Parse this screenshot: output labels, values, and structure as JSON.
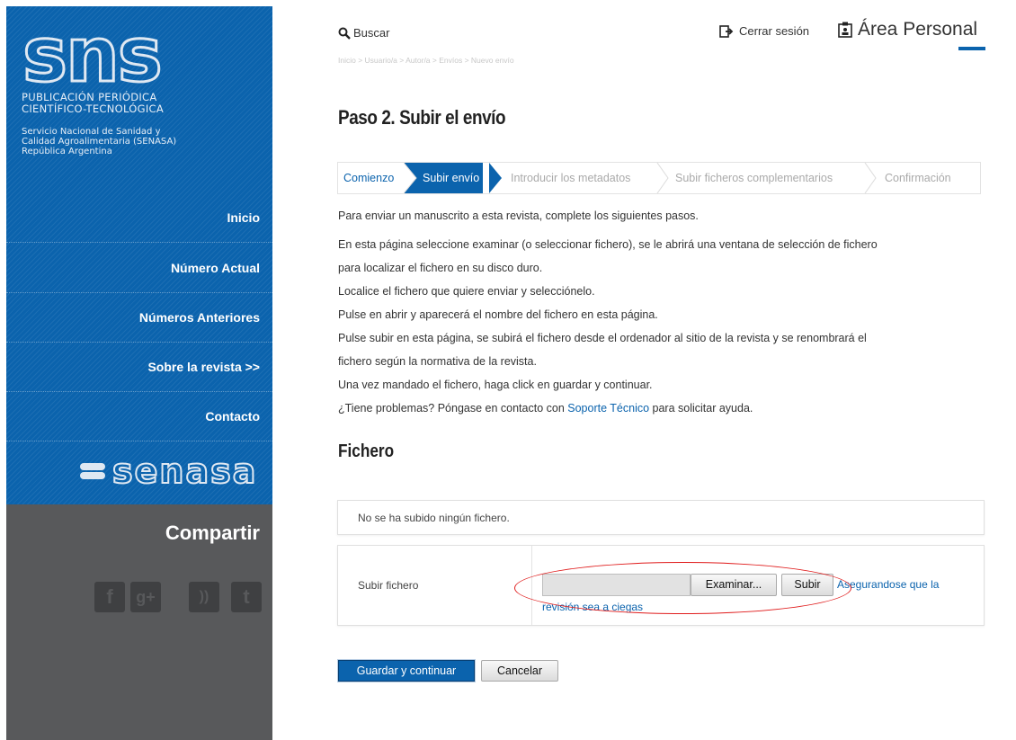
{
  "sidebar": {
    "logo_text": "sns",
    "pub_line1": "PUBLICACIÓN   PERIÓDICA",
    "pub_line2": "CIENTÍFICO-TECNOLÓGICA",
    "service_line1": "Servicio Nacional de Sanidad y",
    "service_line2": "Calidad Agroalimentaria (SENASA)",
    "service_line3": "República Argentina",
    "nav": [
      "Inicio",
      "Número Actual",
      "Números Anteriores",
      "Sobre la revista >>",
      "Contacto"
    ],
    "senasa_logo": "senasa",
    "share_title": "Compartir",
    "social_icons": [
      "facebook-icon",
      "google-plus-icon",
      "rss-icon",
      "twitter-icon"
    ],
    "social_glyphs": [
      "f",
      "g+",
      "))",
      "t"
    ]
  },
  "header": {
    "search_label": "Buscar",
    "logout_label": "Cerrar sesión",
    "personal_area_label": "Área Personal",
    "breadcrumb": "Inicio > Usuario/a > Autor/a > Envíos > Nuevo envío"
  },
  "main": {
    "title": "Paso 2. Subir el envío",
    "steps": [
      "Comienzo",
      "Subir envío",
      "Introducir los metadatos",
      "Subir ficheros complementarios",
      "Confirmación"
    ],
    "active_step": "Subir envío",
    "paragraphs": [
      "Para enviar un manuscrito a esta revista, complete los siguientes pasos.",
      "En esta página seleccione examinar (o seleccionar fichero), se le abrirá una ventana de selección de fichero",
      "para localizar el fichero en su disco duro.",
      "Localice el fichero que quiere enviar y selecciónelo.",
      "Pulse en abrir y aparecerá el nombre del fichero en esta página.",
      "Pulse subir en esta página, se subirá el fichero desde el ordenador al sitio de la revista y se renombrará el",
      "fichero según la normativa de la revista.",
      "Una vez mandado el fichero, haga click en guardar y continuar."
    ],
    "help_prefix": "¿Tiene problemas? Póngase en contacto con ",
    "help_link": "Soporte Técnico",
    "help_suffix": " para solicitar ayuda.",
    "file_section_title": "Fichero",
    "no_file_text": "No se ha subido ningún fichero.",
    "upload_label": "Subir fichero",
    "browse_button": "Examinar...",
    "upload_button": "Subir",
    "blind_review_link_line1": "Asegurandose que la",
    "blind_review_link_line2": "revisión sea a ciegas",
    "save_button": "Guardar y continuar",
    "cancel_button": "Cancelar"
  },
  "colors": {
    "brand_blue": "#0b63ad",
    "sidebar_gray": "#58595b",
    "annotation_red": "#e01c1c"
  }
}
